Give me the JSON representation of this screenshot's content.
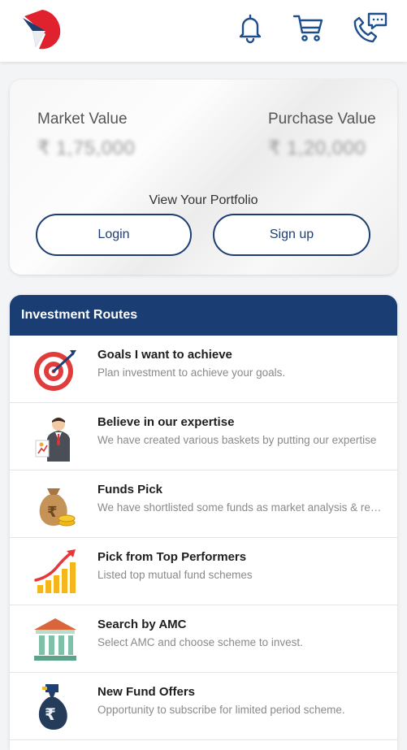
{
  "header": {
    "logo_icon": "arrow-logo-icon",
    "icons": [
      "bell-icon",
      "cart-icon",
      "phone-chat-icon"
    ]
  },
  "portfolio": {
    "market_value_label": "Market Value",
    "market_value": "₹ 1,75,000",
    "purchase_value_label": "Purchase Value",
    "purchase_value": "₹ 1,20,000",
    "view_label": "View Your Portfolio",
    "login_label": "Login",
    "signup_label": "Sign up"
  },
  "routes": {
    "header": "Investment Routes",
    "items": [
      {
        "title": "Goals I want to achieve",
        "desc": "Plan investment to achieve your goals.",
        "icon": "target-icon"
      },
      {
        "title": "Believe in our expertise",
        "desc": "We have created various baskets by putting our expertise",
        "icon": "expert-icon"
      },
      {
        "title": "Funds Pick",
        "desc": "We have shortlisted some funds as market analysis & research",
        "icon": "money-bag-icon"
      },
      {
        "title": "Pick from Top Performers",
        "desc": "Listed top mutual fund schemes",
        "icon": "growth-chart-icon"
      },
      {
        "title": "Search by AMC",
        "desc": "Select AMC and choose scheme to invest.",
        "icon": "bank-icon"
      },
      {
        "title": "New Fund Offers",
        "desc": "Opportunity to subscribe for limited period scheme.",
        "icon": "rupee-bag-icon"
      }
    ]
  },
  "colors": {
    "brand_navy": "#1a3d73",
    "logo_red": "#e0222e",
    "icon_blue": "#1e4f8c"
  }
}
